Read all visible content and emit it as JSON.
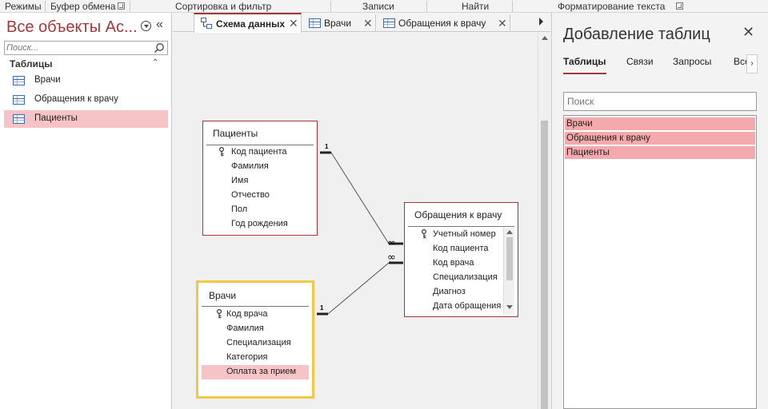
{
  "ribbon": {
    "groups": [
      "Режимы",
      "Буфер обмена",
      "Сортировка и фильтр",
      "Записи",
      "Найти",
      "Форматирование текста"
    ]
  },
  "nav": {
    "title": "Все объекты Ac...",
    "search_placeholder": "Поиск...",
    "section": "Таблицы",
    "items": [
      {
        "label": "Врачи",
        "selected": false
      },
      {
        "label": "Обращения к врачу",
        "selected": false
      },
      {
        "label": "Пациенты",
        "selected": true
      }
    ]
  },
  "tabs": [
    {
      "label": "Схема данных",
      "active": true
    },
    {
      "label": "Врачи",
      "active": false
    },
    {
      "label": "Обращения к врачу",
      "active": false
    }
  ],
  "diagram": {
    "tables": [
      {
        "name": "Пациенты",
        "fields": [
          "Код пациента",
          "Фамилия",
          "Имя",
          "Отчество",
          "Пол",
          "Год рождения"
        ],
        "key": "Код пациента"
      },
      {
        "name": "Врачи",
        "fields": [
          "Код врача",
          "Фамилия",
          "Специализация",
          "Категория",
          "Оплата за прием"
        ],
        "key": "Код врача",
        "highlighted": "Оплата за прием",
        "focused": true
      },
      {
        "name": "Обращения к врачу",
        "fields": [
          "Учетный номер",
          "Код пациента",
          "Код врача",
          "Специализация",
          "Диагноз",
          "Дата обращения"
        ],
        "key": "Учетный номер"
      }
    ],
    "relations": [
      {
        "from": "Пациенты",
        "to": "Обращения к врачу",
        "one": "1",
        "many": "∞"
      },
      {
        "from": "Врачи",
        "to": "Обращения к врачу",
        "one": "1",
        "many": "∞"
      }
    ]
  },
  "right_pane": {
    "title": "Добавление таблиц",
    "tabs": [
      "Таблицы",
      "Связи",
      "Запросы",
      "Все"
    ],
    "search_placeholder": "Поиск",
    "items": [
      "Врачи",
      "Обращения к врачу",
      "Пациенты"
    ]
  },
  "colors": {
    "accent": "#a4373a",
    "selection": "#f6c3c6",
    "focus": "#f2c744"
  }
}
